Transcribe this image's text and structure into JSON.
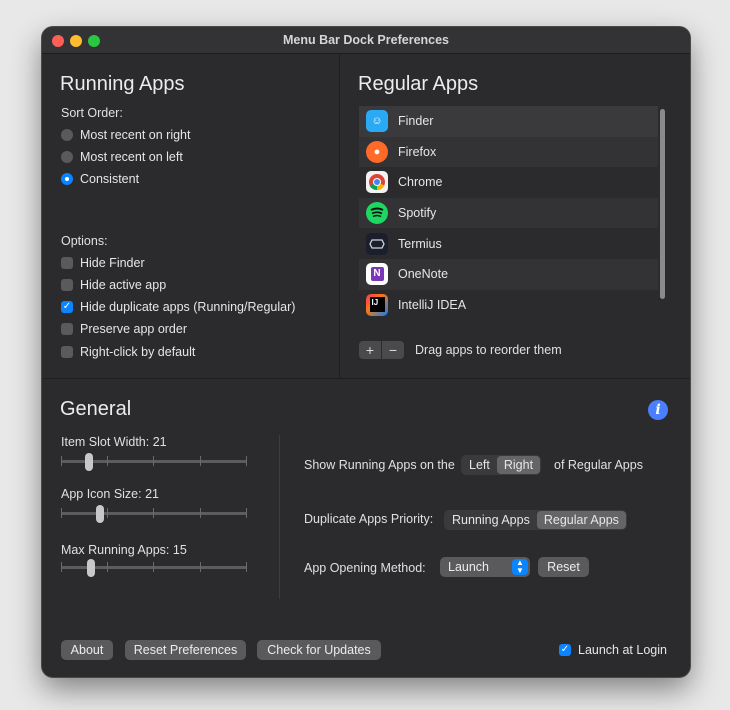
{
  "window": {
    "title": "Menu Bar Dock Preferences"
  },
  "running": {
    "heading": "Running Apps",
    "sort_label": "Sort Order:",
    "sort_options": [
      "Most recent on right",
      "Most recent on left",
      "Consistent"
    ],
    "sort_selected": "Consistent",
    "options_label": "Options:",
    "options": [
      {
        "label": "Hide Finder",
        "checked": false
      },
      {
        "label": "Hide active app",
        "checked": false
      },
      {
        "label": "Hide duplicate apps (Running/Regular)",
        "checked": true
      },
      {
        "label": "Preserve app order",
        "checked": false
      },
      {
        "label": "Right-click by default",
        "checked": false
      }
    ]
  },
  "regular": {
    "heading": "Regular Apps",
    "apps": [
      {
        "name": "Finder",
        "icon": "finder-icon",
        "color": "#2aa9f5"
      },
      {
        "name": "Firefox",
        "icon": "firefox-icon",
        "color": "#ff6a28"
      },
      {
        "name": "Chrome",
        "icon": "chrome-icon",
        "color": "#f2f2f2"
      },
      {
        "name": "Spotify",
        "icon": "spotify-icon",
        "color": "#1ed760"
      },
      {
        "name": "Termius",
        "icon": "termius-icon",
        "color": "#1b1f2c"
      },
      {
        "name": "OneNote",
        "icon": "onenote-icon",
        "color": "#7b37b7"
      },
      {
        "name": "IntelliJ IDEA",
        "icon": "intellij-icon",
        "color": "#1e1e1e"
      }
    ],
    "add_label": "+",
    "remove_label": "−",
    "hint": "Drag apps to reorder them"
  },
  "general": {
    "heading": "General",
    "item_slot_width": {
      "label": "Item Slot Width:",
      "value": "21",
      "level": 0.15
    },
    "app_icon_size": {
      "label": "App Icon Size:",
      "value": "21",
      "level": 0.21
    },
    "max_running_apps": {
      "label": "Max Running Apps:",
      "value": "15",
      "level": 0.16
    },
    "position_label": "Show Running Apps on the",
    "position_options": [
      "Left",
      "Right"
    ],
    "position_selected": "Right",
    "position_suffix": "of Regular Apps",
    "priority_label": "Duplicate Apps Priority:",
    "priority_options": [
      "Running Apps",
      "Regular Apps"
    ],
    "priority_selected": "Regular Apps",
    "opening_label": "App Opening Method:",
    "opening_value": "Launch",
    "reset_label": "Reset"
  },
  "footer": {
    "about": "About",
    "reset_prefs": "Reset Preferences",
    "check_updates": "Check for Updates",
    "launch_at_login": "Launch at Login",
    "launch_checked": true
  }
}
